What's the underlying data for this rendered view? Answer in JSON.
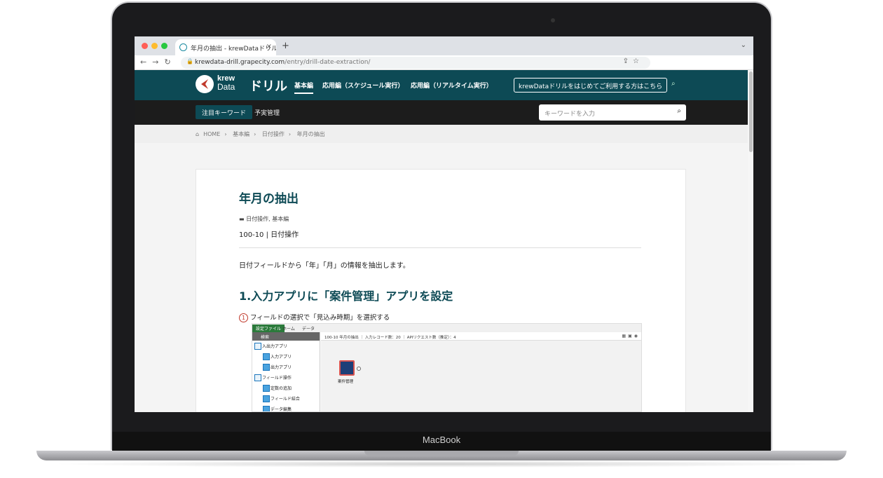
{
  "device": {
    "brand": "MacBook"
  },
  "browser": {
    "tab_title": "年月の抽出 - krewDataドリル",
    "tab_close": "×",
    "new_tab": "+",
    "url_domain": "krewdata-drill.grapecity.com",
    "url_path": "/entry/drill-date-extraction/"
  },
  "site": {
    "logo_top": "krew",
    "logo_bottom": "Data",
    "logo_title": "ドリル",
    "nav": [
      {
        "label": "基本編"
      },
      {
        "label": "応用編（スケジュール実行）"
      },
      {
        "label": "応用編（リアルタイム実行）"
      }
    ],
    "cta": "krewDataドリルをはじめてご利用する方はこちら",
    "keyword_button": "注目キーワード",
    "keyword_link": "予実管理",
    "search_placeholder": "キーワードを入力"
  },
  "breadcrumb": [
    "HOME",
    "基本編",
    "日付操作",
    "年月の抽出"
  ],
  "article": {
    "title": "年月の抽出",
    "categories": "日付操作, 基本編",
    "subtitle": "100-10 | 日付操作",
    "lead": "日付フィールドから「年」「月」の情報を抽出します。",
    "section_title": "1.入力アプリに「案件管理」アプリを設定",
    "step_num": "1",
    "step_text": "フィールドの選択で「見込み時期」を選択する"
  },
  "app_shot": {
    "ribbon_tabs": [
      "設定ファイル",
      "ホーム",
      "データ"
    ],
    "search": "検索",
    "tree": [
      {
        "label": "入出力アプリ",
        "child": false
      },
      {
        "label": "入力アプリ",
        "child": true
      },
      {
        "label": "出力アプリ",
        "child": true
      },
      {
        "label": "フィールド操作",
        "child": false
      },
      {
        "label": "定数の追加",
        "child": true
      },
      {
        "label": "フィールド結合",
        "child": true
      },
      {
        "label": "データ編集",
        "child": true
      }
    ],
    "canvas_bar": "100-10 年月の抽出 ｜ 入力レコード数：20 ｜ APIリクエスト数（推定）：4",
    "node_label": "案件管理"
  }
}
